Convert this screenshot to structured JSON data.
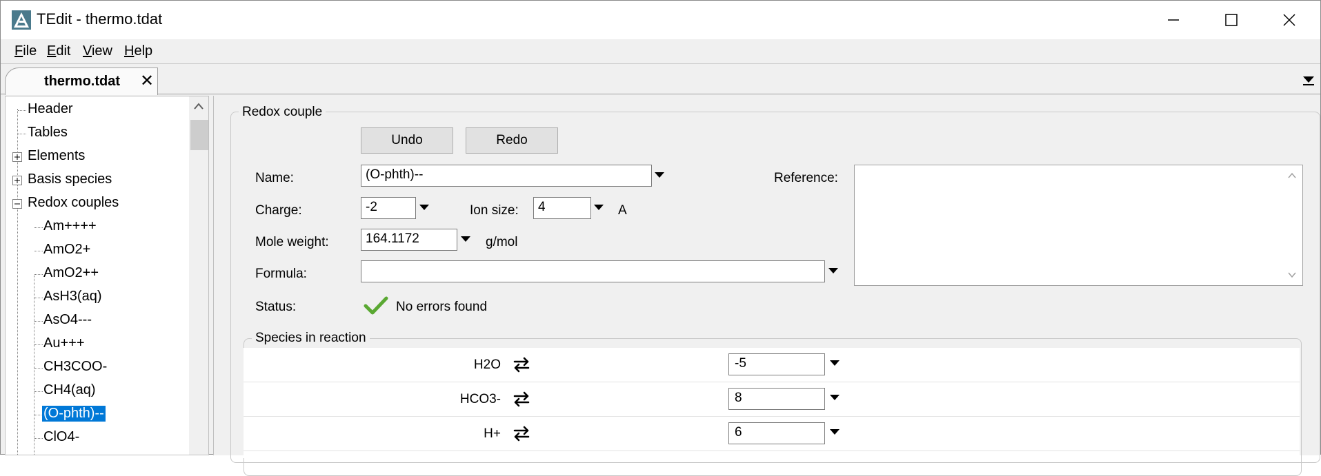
{
  "window": {
    "title": "TEdit - thermo.tdat"
  },
  "menu": {
    "file": {
      "accel": "F",
      "rest": "ile"
    },
    "edit": {
      "accel": "E",
      "rest": "dit"
    },
    "view": {
      "accel": "V",
      "rest": "iew"
    },
    "help": {
      "accel": "H",
      "rest": "elp"
    }
  },
  "tabs": [
    {
      "label": "thermo.tdat",
      "close": "✕"
    }
  ],
  "tree": {
    "items": [
      {
        "label": "Header"
      },
      {
        "label": "Tables"
      },
      {
        "label": "Elements"
      },
      {
        "label": "Basis species"
      },
      {
        "label": "Redox couples"
      },
      {
        "label": "Am++++"
      },
      {
        "label": "AmO2+"
      },
      {
        "label": "AmO2++"
      },
      {
        "label": "AsH3(aq)"
      },
      {
        "label": "AsO4---"
      },
      {
        "label": "Au+++"
      },
      {
        "label": "CH3COO-"
      },
      {
        "label": "CH4(aq)"
      },
      {
        "label": "(O-phth)--"
      },
      {
        "label": "ClO4-"
      }
    ]
  },
  "form": {
    "group_title": "Redox couple",
    "undo_label": "Undo",
    "redo_label": "Redo",
    "name_label": "Name:",
    "name_value": "(O-phth)--",
    "reference_label": "Reference:",
    "charge_label": "Charge:",
    "charge_value": "-2",
    "ion_size_label": "Ion size:",
    "ion_size_value": "4",
    "ion_size_unit": "A",
    "mole_weight_label": "Mole weight:",
    "mole_weight_value": "164.1172",
    "mole_weight_unit": "g/mol",
    "formula_label": "Formula:",
    "formula_value": "",
    "status_label": "Status:",
    "status_text": "No errors found"
  },
  "species": {
    "group_title": "Species in reaction",
    "rows": [
      {
        "name": "H2O",
        "coef": "-5"
      },
      {
        "name": "HCO3-",
        "coef": "8"
      },
      {
        "name": "H+",
        "coef": "6"
      }
    ]
  },
  "colors": {
    "selection": "#0078d7",
    "status_check": "#5aa832",
    "window_bg": "#f0f0f0"
  }
}
